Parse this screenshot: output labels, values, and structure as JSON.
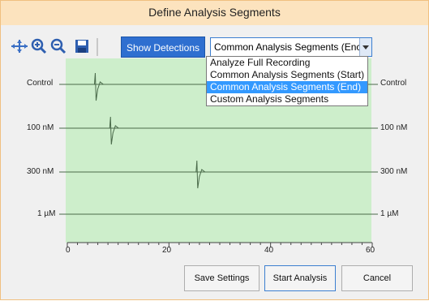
{
  "window": {
    "title": "Define Analysis Segments"
  },
  "toolbar": {
    "icons": [
      "pan-zoom-icon",
      "zoom-in-icon",
      "zoom-out-icon",
      "save-icon"
    ],
    "show_detections_label": "Show Detections",
    "segment_select": {
      "value": "Common Analysis Segments (Enc",
      "options": [
        "Analyze Full Recording",
        "Common Analysis Segments (Start)",
        "Common Analysis Segments (End)",
        "Custom Analysis Segments"
      ],
      "selected_index": 2
    }
  },
  "plot": {
    "traces": [
      {
        "label": "Control",
        "event_time": 5.5
      },
      {
        "label": "100 nM",
        "event_time": 8.5
      },
      {
        "label": "300 nM",
        "event_time": 25.5
      },
      {
        "label": "1 µM",
        "event_time": null
      }
    ],
    "x_ticks": [
      "0",
      "20",
      "40",
      "60"
    ],
    "x_range": [
      0,
      60
    ],
    "colors": {
      "plot_bg": "#cdeecb",
      "trace": "#4a6a4a"
    }
  },
  "buttons": {
    "save_settings": "Save Settings",
    "start_analysis": "Start Analysis",
    "cancel": "Cancel"
  }
}
